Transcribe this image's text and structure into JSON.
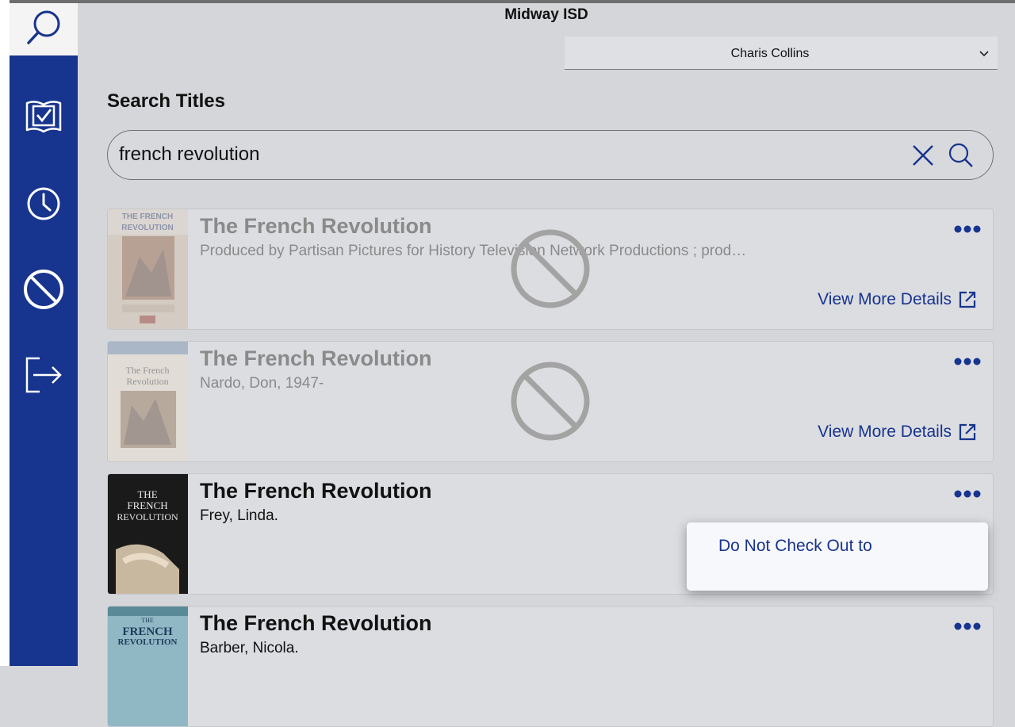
{
  "header": {
    "district": "Midway ISD"
  },
  "user_select": {
    "value": "Charis Collins"
  },
  "page": {
    "heading": "Search Titles"
  },
  "search": {
    "value": "french revolution"
  },
  "sidebar": {
    "items": [
      {
        "icon": "search-icon",
        "active": true
      },
      {
        "icon": "book-check-icon",
        "active": false
      },
      {
        "icon": "clock-icon",
        "active": false
      },
      {
        "icon": "block-icon",
        "active": false
      },
      {
        "icon": "logout-icon",
        "active": false
      }
    ]
  },
  "results": [
    {
      "title": "The French Revolution",
      "author": "Produced by Partisan Pictures for History Television Network Productions ; prod…",
      "blocked": true,
      "details": "View More Details",
      "cover_text": [
        "THE FRENCH",
        "REVOLUTION"
      ]
    },
    {
      "title": "The French Revolution",
      "author": "Nardo, Don, 1947-",
      "blocked": true,
      "details": "View More Details",
      "cover_text": [
        "The French",
        "Revolution"
      ]
    },
    {
      "title": "The French Revolution",
      "author": "Frey, Linda.",
      "blocked": false,
      "cover_text": [
        "THE",
        "FRENCH",
        "REVOLUTION"
      ]
    },
    {
      "title": "The French Revolution",
      "author": "Barber, Nicola.",
      "blocked": false,
      "cover_text": [
        "THE",
        "FRENCH",
        "REVOLUTION"
      ]
    }
  ],
  "popup": {
    "option": "Do Not Check Out to"
  },
  "colors": {
    "sidebar": "#17348e",
    "accent": "#17348e",
    "background": "#d5d6da"
  }
}
